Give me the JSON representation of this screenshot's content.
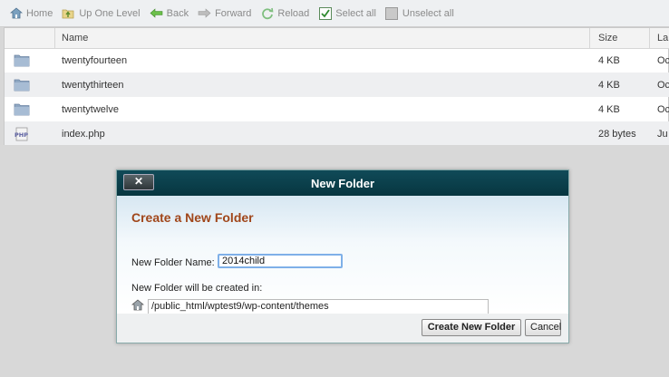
{
  "toolbar": {
    "home": "Home",
    "up_one_level": "Up One Level",
    "back": "Back",
    "forward": "Forward",
    "reload": "Reload",
    "select_all": "Select all",
    "unselect_all": "Unselect all"
  },
  "filelist": {
    "columns": {
      "name": "Name",
      "size": "Size",
      "last_modified": "La"
    },
    "rows": [
      {
        "icon": "folder-icon",
        "name": "twentyfourteen",
        "size": "4 KB",
        "last": "Oc"
      },
      {
        "icon": "folder-icon",
        "name": "twentythirteen",
        "size": "4 KB",
        "last": "Oc"
      },
      {
        "icon": "folder-icon",
        "name": "twentytwelve",
        "size": "4 KB",
        "last": "Oc"
      },
      {
        "icon": "php-file-icon",
        "name": "index.php",
        "size": "28 bytes",
        "last": "Ju"
      }
    ]
  },
  "dialog": {
    "title": "New Folder",
    "close_label": "✕",
    "heading": "Create a New Folder",
    "name_label": "New Folder Name:",
    "name_value": "2014child",
    "location_label": "New Folder will be created in:",
    "path_value": "/public_html/wptest9/wp-content/themes",
    "create_button": "Create New Folder",
    "cancel_button": "Cancel"
  },
  "colors": {
    "dialog_title_bg": "#0b3f4a",
    "heading": "#a0461a",
    "input_focus": "#7fb0e8"
  }
}
